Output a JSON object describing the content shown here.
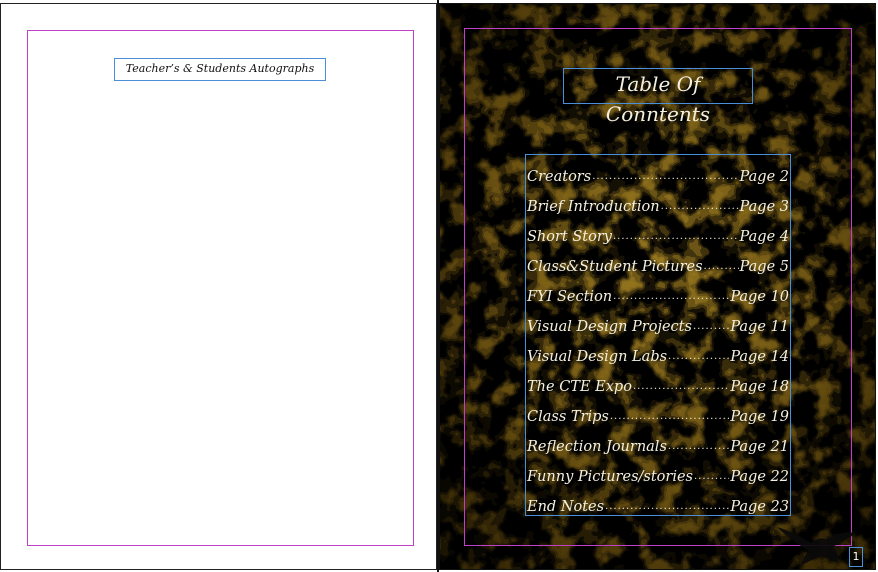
{
  "left_page": {
    "autograph_heading": "Teacher’s & Students Autographs"
  },
  "right_page": {
    "toc_title": "Table Of Conntents",
    "toc_entries": [
      {
        "label": "Creators",
        "page": "Page 2"
      },
      {
        "label": "Brief Introduction",
        "page": "Page 3"
      },
      {
        "label": "Short Story",
        "page": "Page 4"
      },
      {
        "label": "Class&Student Pictures",
        "page": "Page 5"
      },
      {
        "label": "FYI Section",
        "page": "Page 10"
      },
      {
        "label": "Visual Design Projects",
        "page": "Page 11"
      },
      {
        "label": "Visual Design Labs",
        "page": "Page 14"
      },
      {
        "label": "The CTE Expo",
        "page": "Page 18"
      },
      {
        "label": "Class Trips",
        "page": "Page 19"
      },
      {
        "label": "Reflection Journals",
        "page": "Page 21"
      },
      {
        "label": "Funny Pictures/stories",
        "page": "Page 22"
      },
      {
        "label": "End Notes",
        "page": "Page 23"
      }
    ],
    "page_number": "1",
    "decoration_icon": "eagle-silhouette-icon",
    "background_color": "#3a2c08",
    "text_color": "#f4f0e0"
  },
  "colors": {
    "margin_guide": "#c040c8",
    "frame_border": "#4a8fd8"
  }
}
